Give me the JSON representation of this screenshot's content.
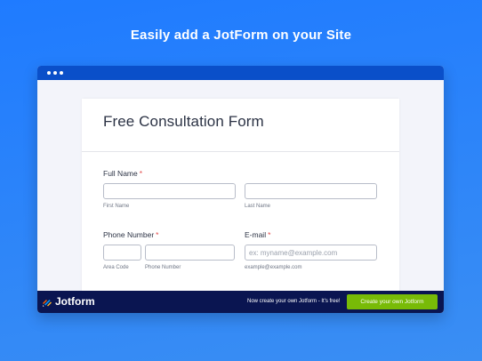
{
  "headline": "Easily add a JotForm on your Site",
  "form": {
    "title": "Free Consultation Form",
    "full_name": {
      "label": "Full Name",
      "required_mark": "*",
      "first_sublabel": "First Name",
      "last_sublabel": "Last Name",
      "first_value": "",
      "last_value": ""
    },
    "phone": {
      "label": "Phone Number",
      "required_mark": "*",
      "area_sublabel": "Area Code",
      "number_sublabel": "Phone Number",
      "area_value": "",
      "number_value": ""
    },
    "email": {
      "label": "E-mail",
      "required_mark": "*",
      "placeholder": "ex: myname@example.com",
      "sublabel": "example@example.com",
      "value": ""
    }
  },
  "footer": {
    "brand": "Jotform",
    "note": "Now create your own Jotform - It's free!",
    "cta_label": "Create your own Jotform"
  },
  "colors": {
    "background": "#1f7bff",
    "titlebar": "#0a4fc9",
    "footer": "#0a1551",
    "cta": "#78bb07",
    "required": "#e24c4c"
  },
  "icons": {
    "logo": "jotform-logo-icon",
    "window_controls": "window-dots-icon"
  }
}
